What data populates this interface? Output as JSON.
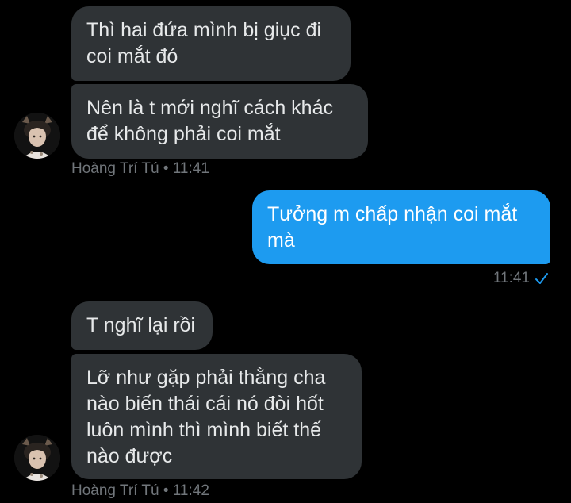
{
  "conversation": {
    "group1": {
      "msg1": "Thì hai đứa mình bị giục đi\ncoi mắt đó",
      "msg2": "Nên là t mới nghĩ cách khác\nđể không phải coi mắt",
      "sender": "Hoàng Trí Tú",
      "separator": "•",
      "time": "11:41"
    },
    "sent": {
      "msg1": "Tưởng m chấp nhận coi mắt\nmà",
      "time": "11:41",
      "status_icon": "check-icon"
    },
    "group2": {
      "msg1": "T nghĩ lại rồi",
      "msg2": "Lỡ như gặp phải thằng cha\nnào biến thái cái nó đòi hốt\nluôn mình thì mình biết thế\nnào được",
      "sender": "Hoàng Trí Tú",
      "separator": "•",
      "time": "11:42"
    }
  },
  "colors": {
    "background": "#000000",
    "incoming_bubble": "#2f3336",
    "outgoing_bubble": "#1d9bf0",
    "meta_text": "#71767b"
  }
}
